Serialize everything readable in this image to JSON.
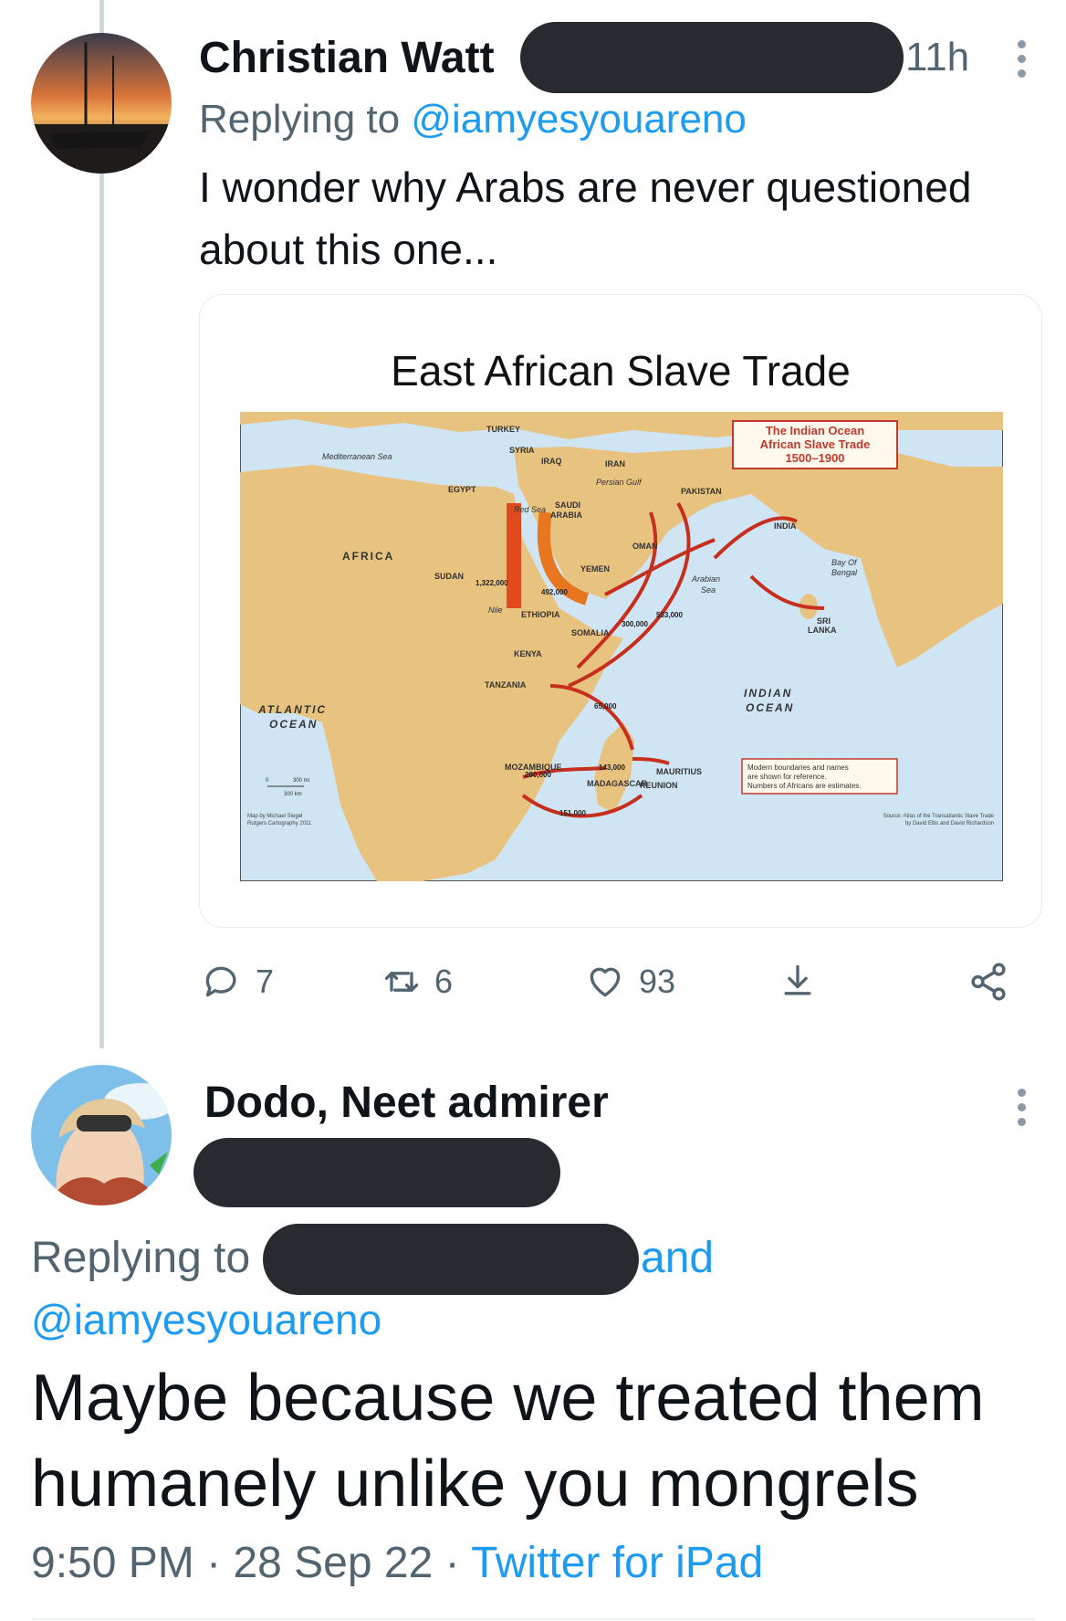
{
  "tweet1": {
    "author_name": "Christian Watt",
    "time": "11h",
    "replying_prefix": "Replying to ",
    "replying_handle": "@iamyesyouareno",
    "text_line1": "I wonder why Arabs are never questioned",
    "text_line2": "about this one...",
    "media": {
      "title": "East African Slave Trade",
      "legend_title": [
        "The Indian Ocean",
        "African Slave Trade",
        "1500–1900"
      ],
      "labels": {
        "turkey": "TURKEY",
        "syria": "SYRIA",
        "iraq": "IRAQ",
        "iran": "IRAN",
        "egypt": "EGYPT",
        "saudi": "SAUDI",
        "arabia": "ARABIA",
        "pakistan": "PAKISTAN",
        "india": "INDIA",
        "africa": "AFRICA",
        "sudan": "SUDAN",
        "yemen": "YEMEN",
        "oman": "OMAN",
        "ethiopia": "ETHIOPIA",
        "somalia": "SOMALIA",
        "kenya": "KENYA",
        "tanzania": "TANZANIA",
        "mozambique": "MOZAMBIQUE",
        "madagascar": "MADAGASCAR",
        "mauritius": "MAURITIUS",
        "reunion": "REUNION",
        "sri": "SRI",
        "lanka": "LANKA",
        "med_sea": "Mediterranean Sea",
        "red_sea": "Red Sea",
        "persian_gulf": "Persian Gulf",
        "arabian": "Arabian",
        "sea": "Sea",
        "bay_of": "Bay Of",
        "bengal": "Bengal",
        "nile": "Nile",
        "atlantic": "ATLANTIC",
        "ocean": "OCEAN",
        "indian": "INDIAN"
      },
      "figures": {
        "nile_route": "1,322,000",
        "red_sea_route": "492,000",
        "somali_route": "300,000",
        "swahili_route": "533,000",
        "to_mauritius": "65,000",
        "mozambique_route": "200,000",
        "madagascar_route": "143,000",
        "southern_route": "151,000"
      },
      "scale": {
        "mi": "300 mi",
        "km": "300 km",
        "zero": "0"
      },
      "notes": [
        "Modern boundaries and names",
        "are shown for reference.",
        "Numbers of Africans are estimates."
      ],
      "credit": [
        "Map by Michael Siegel",
        "Rutgers Cartography 2011"
      ],
      "source": [
        "Source: Atlas of the Transatlantic Slave Trade",
        "by David Eltis and David Richardson"
      ],
      "colors": {
        "land": "#e8c27f",
        "sea": "#cfe5f4",
        "arrow": "#c62f1e",
        "legend_border": "#c0392b"
      }
    },
    "stats": {
      "replies": "7",
      "retweets": "6",
      "likes": "93"
    }
  },
  "tweet2": {
    "author_name": "Dodo, Neet admirer",
    "replying_prefix": "Replying to",
    "replying_and": "and",
    "replying_handle": "@iamyesyouareno",
    "text_line1": "Maybe because we treated them",
    "text_line2": "humanely unlike you mongrels",
    "time": "9:50 PM",
    "separator": "·",
    "date": "28 Sep 22",
    "source": "Twitter for iPad"
  },
  "icons": [
    "reply-icon",
    "retweet-icon",
    "like-icon",
    "share-icon",
    "share-network-icon",
    "more-icon"
  ]
}
